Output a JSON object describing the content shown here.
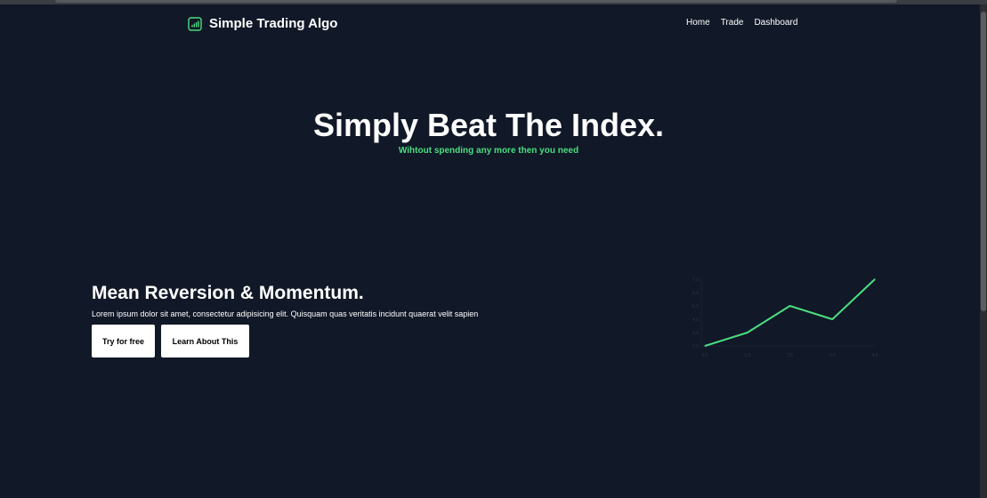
{
  "brand": {
    "name": "Simple Trading Algo",
    "icon": "bar-chart-icon",
    "accent": "#4ade80"
  },
  "nav": {
    "items": [
      "Home",
      "Trade",
      "Dashboard"
    ]
  },
  "hero": {
    "title": "Simply Beat The Index.",
    "subtitle": "Wihtout spending any more then you need"
  },
  "feature": {
    "title": "Mean Reversion & Momentum.",
    "description": "Lorem ipsum dolor sit amet, consectetur adipisicing elit. Quisquam quas veritatis incidunt quaerat velit sapien",
    "buttons": {
      "try": "Try for free",
      "learn": "Learn About This"
    }
  },
  "chart_data": {
    "type": "line",
    "x": [
      0,
      1,
      2,
      3,
      4
    ],
    "values": [
      2,
      3,
      5,
      4,
      7
    ],
    "x_tick_labels": [
      "0.0",
      "1.0",
      "2.0",
      "3.0",
      "4.0"
    ],
    "y_tick_labels": [
      "2.0",
      "3.0",
      "4.0",
      "5.0",
      "6.0",
      "7.0"
    ],
    "xlim": [
      0,
      4
    ],
    "ylim": [
      2,
      7
    ],
    "color": "#4ade80",
    "grid": false
  }
}
